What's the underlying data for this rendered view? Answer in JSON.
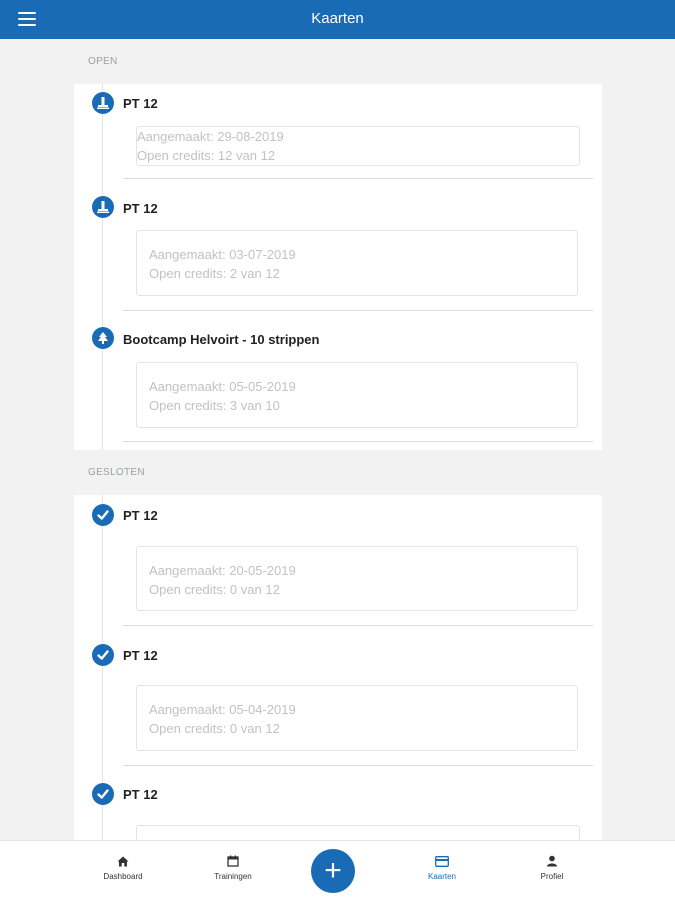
{
  "header": {
    "title": "Kaarten"
  },
  "sections": {
    "open_label": "OPEN",
    "closed_label": "GESLOTEN"
  },
  "open_cards": [
    {
      "name": "PT 12",
      "created": "Aangemaakt: 29-08-2019",
      "credits": "Open credits: 12 van 12",
      "icon": "weight-icon"
    },
    {
      "name": "PT 12",
      "created": "Aangemaakt: 03-07-2019",
      "credits": "Open credits: 2 van 12",
      "icon": "weight-icon"
    },
    {
      "name": "Bootcamp Helvoirt - 10 strippen",
      "created": "Aangemaakt: 05-05-2019",
      "credits": "Open credits: 3 van 10",
      "icon": "tree-icon"
    }
  ],
  "closed_cards": [
    {
      "name": "PT 12",
      "created": "Aangemaakt: 20-05-2019",
      "credits": "Open credits: 0 van 12",
      "icon": "check-icon"
    },
    {
      "name": "PT 12",
      "created": "Aangemaakt: 05-04-2019",
      "credits": "Open credits: 0 van 12",
      "icon": "check-icon"
    },
    {
      "name": "PT 12",
      "icon": "check-icon"
    }
  ],
  "bottom_nav": {
    "dashboard": "Dashboard",
    "trainingen": "Trainingen",
    "add": "+",
    "kaarten": "Kaarten",
    "profiel": "Profiel"
  },
  "colors": {
    "accent": "#1a6bb5",
    "background": "#f2f2f2"
  }
}
